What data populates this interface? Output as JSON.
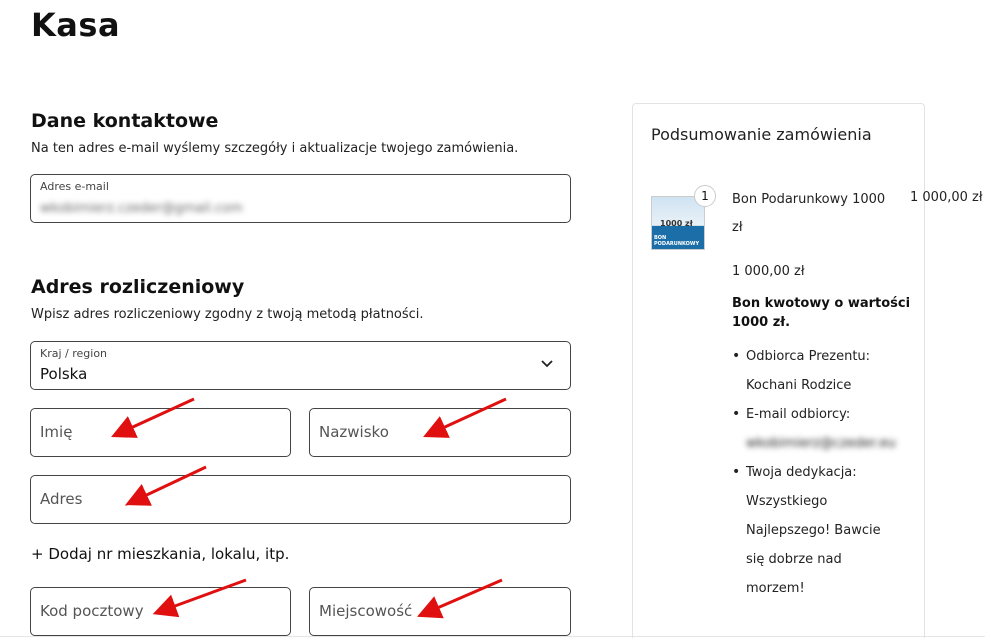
{
  "page": {
    "title": "Kasa"
  },
  "contact": {
    "title": "Dane kontaktowe",
    "description": "Na ten adres e-mail wyślemy szczegóły i aktualizacje twojego zamówienia.",
    "email_label": "Adres e-mail",
    "email_value": "wkobimierz.czeder@gmail.com"
  },
  "billing": {
    "title": "Adres rozliczeniowy",
    "description": "Wpisz adres rozliczeniowy zgodny z twoją metodą płatności.",
    "country_label": "Kraj / region",
    "country_value": "Polska",
    "first_name_placeholder": "Imię",
    "last_name_placeholder": "Nazwisko",
    "address_placeholder": "Adres",
    "add_apartment_link": "+ Dodaj nr mieszkania, lokalu, itp.",
    "postcode_placeholder": "Kod pocztowy",
    "city_placeholder": "Miejscowość"
  },
  "summary": {
    "title": "Podsumowanie zamówienia",
    "item": {
      "quantity": "1",
      "name": "Bon Podarunkowy 1000 zł",
      "price": "1 000,00 zł",
      "unit_price": "1 000,00 zł",
      "description": "Bon kwotowy o wartości 1000 zł.",
      "thumb_main": "1000 zł",
      "thumb_sub": "BON PODARUNKOWY",
      "meta": [
        {
          "text": "Odbiorca Prezentu: Kochani Rodzice",
          "blurred": false
        },
        {
          "text": "E-mail odbiorcy:",
          "blurred": false
        },
        {
          "text": "wkobimierz@czeder.eu",
          "blurred": true
        },
        {
          "text": "Twoja dedykacja: Wszystkiego Najlepszego! Bawcie się dobrze nad morzem!",
          "blurred": false
        }
      ]
    }
  },
  "colors": {
    "annotation_arrow": "#e01010",
    "border": "#444444"
  }
}
